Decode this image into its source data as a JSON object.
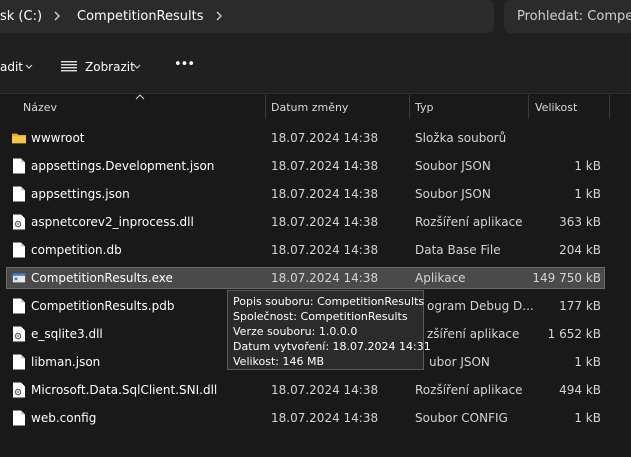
{
  "address": {
    "crumbs": [
      "sk (C:)",
      "CompetitionResults"
    ],
    "search_placeholder": "Prohledat: Compet"
  },
  "toolbar": {
    "sort_label": "adit",
    "view_label": "Zobrazit",
    "more_label": "•••"
  },
  "columns": {
    "name": "Název",
    "date": "Datum změny",
    "type": "Typ",
    "size": "Velikost"
  },
  "files": [
    {
      "name": "wwwroot",
      "date": "18.07.2024 14:38",
      "type": "Složka souborů",
      "size": "",
      "icon": "folder-icon"
    },
    {
      "name": "appsettings.Development.json",
      "date": "18.07.2024 14:38",
      "type": "Soubor JSON",
      "size": "1 kB",
      "icon": "file-icon"
    },
    {
      "name": "appsettings.json",
      "date": "18.07.2024 14:38",
      "type": "Soubor JSON",
      "size": "1 kB",
      "icon": "file-icon"
    },
    {
      "name": "aspnetcorev2_inprocess.dll",
      "date": "18.07.2024 14:38",
      "type": "Rozšíření aplikace",
      "size": "363 kB",
      "icon": "dll-icon"
    },
    {
      "name": "competition.db",
      "date": "18.07.2024 14:38",
      "type": "Data Base File",
      "size": "204 kB",
      "icon": "file-icon"
    },
    {
      "name": "CompetitionResults.exe",
      "date": "18.07.2024 14:38",
      "type": "Aplikace",
      "size": "149 750 kB",
      "icon": "exe-icon"
    },
    {
      "name": "CompetitionResults.pdb",
      "date": "",
      "type": "ogram Debug D...",
      "size": "177 kB",
      "icon": "file-icon"
    },
    {
      "name": "e_sqlite3.dll",
      "date": "",
      "type": "zšíření aplikace",
      "size": "1 652 kB",
      "icon": "dll-icon"
    },
    {
      "name": "libman.json",
      "date": "",
      "type": "ubor JSON",
      "size": "1 kB",
      "icon": "file-icon"
    },
    {
      "name": "Microsoft.Data.SqlClient.SNI.dll",
      "date": "18.07.2024 14:38",
      "type": "Rozšíření aplikace",
      "size": "494 kB",
      "icon": "dll-icon"
    },
    {
      "name": "web.config",
      "date": "18.07.2024 14:38",
      "type": "Soubor CONFIG",
      "size": "1 kB",
      "icon": "file-icon"
    }
  ],
  "tooltip": {
    "lines": [
      "Popis souboru: CompetitionResults",
      "Společnost: CompetitionResults",
      "Verze souboru: 1.0.0.0",
      "Datum vytvoření: 18.07.2024 14:31",
      "Velikost: 146 MB"
    ]
  }
}
